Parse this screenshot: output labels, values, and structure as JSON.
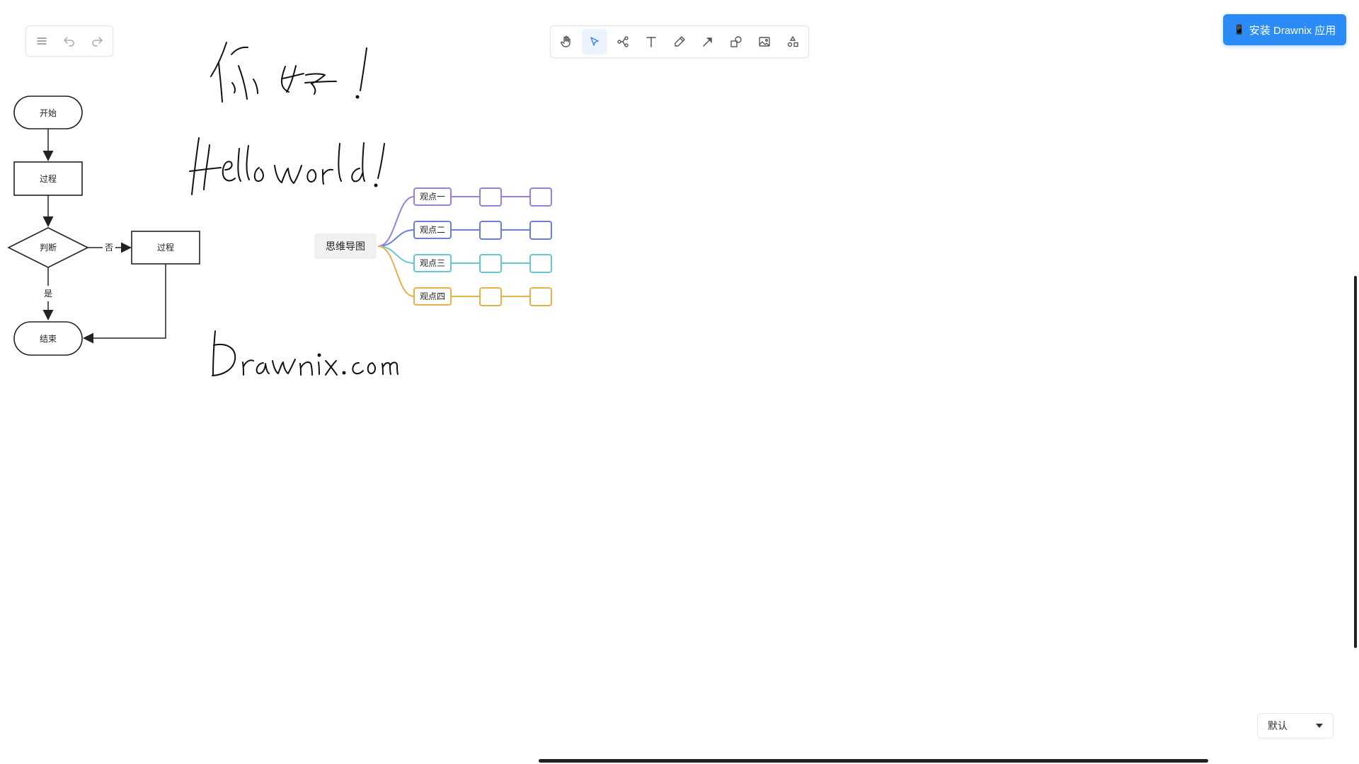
{
  "app": {
    "install_button_label": "安装 Drawnix 应用",
    "theme_select_value": "默认"
  },
  "left_toolbar": {
    "icons": [
      "menu-icon",
      "undo-icon",
      "redo-icon"
    ]
  },
  "main_toolbar": {
    "tools": [
      "hand-icon",
      "pointer-icon",
      "mindmap-icon",
      "text-icon",
      "pen-icon",
      "arrow-icon",
      "shape-icon",
      "image-icon",
      "extra-tools-icon"
    ],
    "active_tool": "pointer-icon",
    "accent_color": "#3b82f6"
  },
  "flowchart": {
    "start": "开始",
    "process1": "过程",
    "decision": "判断",
    "no_label": "否",
    "process2": "过程",
    "yes_label": "是",
    "end": "结束"
  },
  "mindmap": {
    "root": "思维导图",
    "branches": [
      {
        "label": "观点一",
        "color": "#9b7ee0"
      },
      {
        "label": "观点二",
        "color": "#6a7fdb"
      },
      {
        "label": "观点三",
        "color": "#67c6d0"
      },
      {
        "label": "观点四",
        "color": "#e8b04a"
      }
    ]
  },
  "handwriting": {
    "line1": "你好！",
    "line2": "Hello world !",
    "line3": "Drawnix.com"
  }
}
